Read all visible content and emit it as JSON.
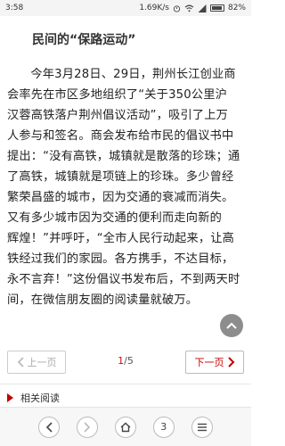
{
  "status_bar": {
    "time": "3:58",
    "speed": "1.69K/s",
    "battery": "82%"
  },
  "article": {
    "section_title": "民间的“保路运动”",
    "lines": [
      "今年3月28日、29日，荆州长江创业商",
      "会率先在市区多地组织了“关于350公里沪",
      "汉蓉高铁落户荆州倡议活动”，吸引了上万",
      "人参与和签名。商会发布给市民的倡议书中",
      "提出：“没有高铁，城镇就是散落的珍珠；通",
      "了高铁，城镇就是项链上的珍珠。多少曾经",
      "繁荣昌盛的城市，因为交通的衰减而消失。",
      "又有多少城市因为交通的便利而走向新的",
      "辉煌！”并呼吁，“全市人民行动起来，让高",
      "铁经过我们的家园。各方携手，不达目标，",
      "永不言弃！”这份倡议书发布后，不到两天时",
      "间，在微信朋友圈的阅读量就破万。"
    ]
  },
  "pager": {
    "prev_label": "上一页",
    "next_label": "下一页",
    "current": "1",
    "total": "/5"
  },
  "related": {
    "label": "相关阅读"
  },
  "bottom_nav": {
    "tabs_count": "3"
  },
  "colors": {
    "accent": "#c40000",
    "status_bg": "#f4f4f4"
  }
}
